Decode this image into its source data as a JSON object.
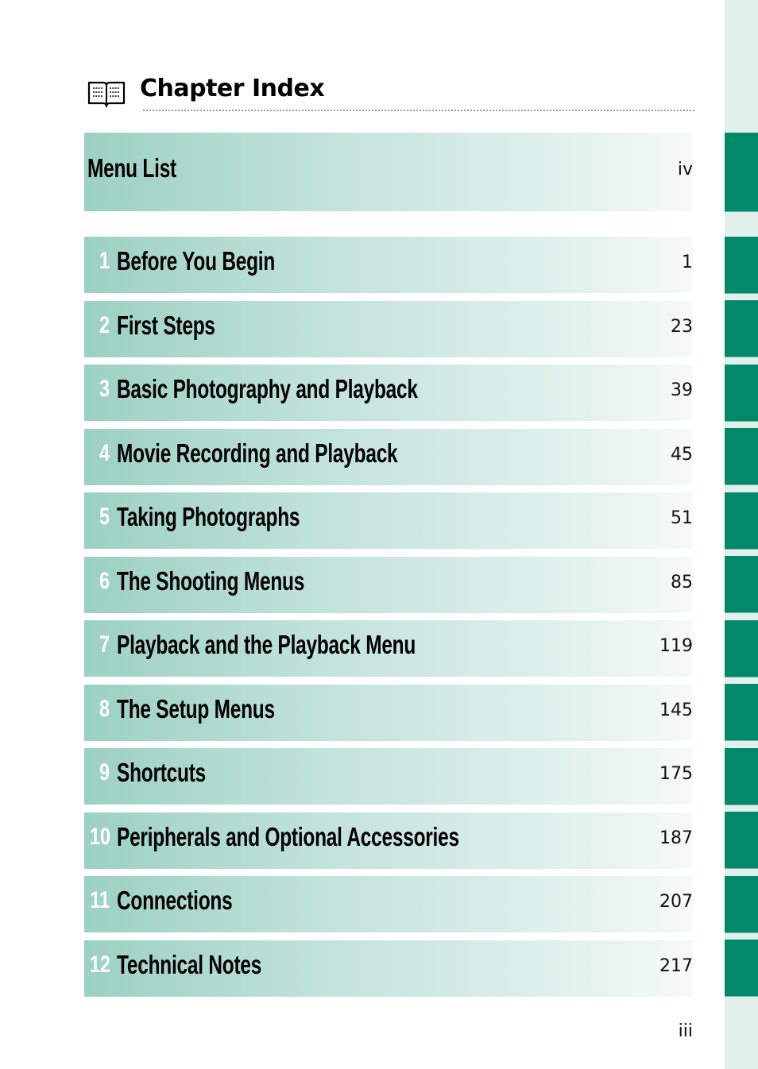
{
  "header": {
    "icon": "open-book-icon",
    "title": "Chapter Index"
  },
  "menu_list": {
    "label": "Menu List",
    "page": "iv"
  },
  "chapters": [
    {
      "number": "1",
      "title": "Before You Begin",
      "page": "1"
    },
    {
      "number": "2",
      "title": "First Steps",
      "page": "23"
    },
    {
      "number": "3",
      "title": "Basic Photography and Playback",
      "page": "39"
    },
    {
      "number": "4",
      "title": "Movie Recording and Playback",
      "page": "45"
    },
    {
      "number": "5",
      "title": "Taking Photographs",
      "page": "51"
    },
    {
      "number": "6",
      "title": "The Shooting Menus",
      "page": "85"
    },
    {
      "number": "7",
      "title": "Playback and the Playback Menu",
      "page": "119"
    },
    {
      "number": "8",
      "title": "The Setup Menus",
      "page": "145"
    },
    {
      "number": "9",
      "title": "Shortcuts",
      "page": "175"
    },
    {
      "number": "10",
      "title": "Peripherals and Optional Accessories",
      "page": "187"
    },
    {
      "number": "11",
      "title": "Connections",
      "page": "207"
    },
    {
      "number": "12",
      "title": "Technical Notes",
      "page": "217"
    }
  ],
  "footer": {
    "page_number": "iii"
  },
  "colors": {
    "tab_green": "#008a69",
    "strip_mint": "#e2f0ec",
    "row_gradient_start": "#9cd1c2",
    "row_gradient_end": "#f6faf9"
  }
}
